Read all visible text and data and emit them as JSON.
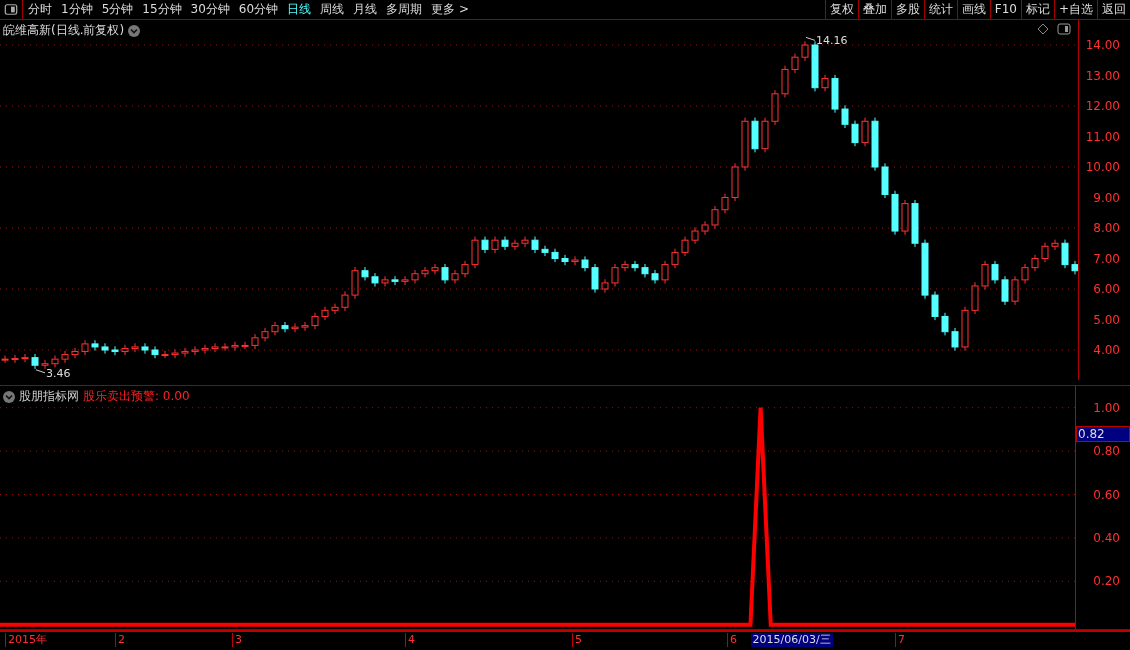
{
  "toolbar": {
    "tabs": [
      {
        "label": "分时",
        "selected": false
      },
      {
        "label": "1分钟",
        "selected": false
      },
      {
        "label": "5分钟",
        "selected": false
      },
      {
        "label": "15分钟",
        "selected": false
      },
      {
        "label": "30分钟",
        "selected": false
      },
      {
        "label": "60分钟",
        "selected": false
      },
      {
        "label": "日线",
        "selected": true
      },
      {
        "label": "周线",
        "selected": false
      },
      {
        "label": "月线",
        "selected": false
      },
      {
        "label": "多周期",
        "selected": false
      },
      {
        "label": "更多 >",
        "selected": false
      }
    ],
    "buttons": [
      "复权",
      "叠加",
      "多股",
      "统计",
      "画线",
      "F10",
      "标记",
      "+自选",
      "返回"
    ]
  },
  "price_panel": {
    "title": "皖维高新(日线.前复权)",
    "axis_labels": [
      "14.00",
      "13.00",
      "12.00",
      "11.00",
      "10.00",
      "9.00",
      "8.00",
      "7.00",
      "6.00",
      "5.00",
      "4.00"
    ],
    "high_label": "14.16",
    "low_label": "3.46"
  },
  "indicator_panel": {
    "source": "股朋指标网",
    "reading": ": 0.00",
    "cursor_value": "0.82",
    "chart_data": {
      "type": "line",
      "series": [
        {
          "name": "股乐卖出预警",
          "color": "#ff0000",
          "values": [
            0,
            0,
            0,
            0,
            0,
            0,
            0,
            0,
            0,
            0,
            0,
            0,
            0,
            0,
            0,
            0,
            0,
            0,
            0,
            0,
            0,
            0,
            0,
            0,
            0,
            0,
            0,
            0,
            0,
            0,
            0,
            0,
            0,
            0,
            0,
            0,
            0,
            0,
            0,
            0,
            0,
            0,
            0,
            0,
            0,
            0,
            0,
            0,
            0,
            0,
            0,
            0,
            0,
            0,
            0,
            0,
            0,
            0,
            0,
            0,
            0,
            0,
            0,
            0,
            0,
            0,
            0,
            0,
            0,
            0,
            0,
            0,
            0,
            0,
            0,
            1,
            0,
            0,
            0,
            0,
            0,
            0,
            0,
            0,
            0,
            0,
            0,
            0,
            0,
            0,
            0,
            0,
            0,
            0,
            0,
            0,
            0,
            0,
            0,
            0,
            0,
            0,
            0,
            0,
            0,
            0,
            0
          ]
        }
      ],
      "ylim": [
        -0.02,
        1.1
      ],
      "grid": true,
      "yticks": [
        {
          "value": 1,
          "label": "1.00"
        },
        {
          "value": 0.8,
          "label": "0.80"
        },
        {
          "value": 0.6,
          "label": "0.60"
        },
        {
          "value": 0.4,
          "label": "0.40"
        },
        {
          "value": 0.2,
          "label": "0.20"
        }
      ]
    },
    "date_labels": [
      "2015年",
      "2",
      "3",
      "4",
      "5",
      "6",
      "7"
    ],
    "cursor_date": "2015/06/03/三"
  }
}
